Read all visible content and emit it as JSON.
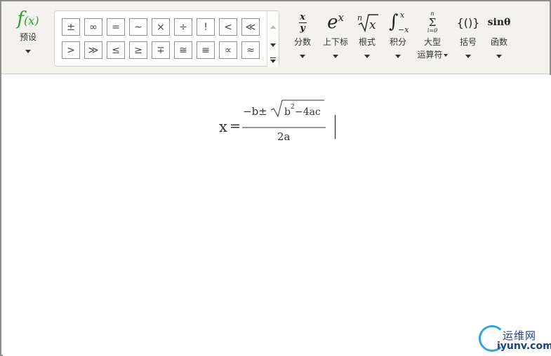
{
  "toolbar": {
    "preset": {
      "glyph": "f",
      "glyph_sub": "(x)",
      "label": "预设"
    },
    "symbols": {
      "row1": [
        "±",
        "∞",
        "=",
        "~",
        "×",
        "÷",
        "!",
        "<",
        "≪"
      ],
      "row2": [
        ">",
        "≫",
        "≤",
        "≥",
        "∓",
        "≅",
        "≡",
        "∝",
        "≈"
      ]
    },
    "tools": [
      {
        "id": "fraction",
        "label": "分数",
        "label2": ""
      },
      {
        "id": "script",
        "label": "上下标",
        "label2": ""
      },
      {
        "id": "radical",
        "label": "根式",
        "label2": ""
      },
      {
        "id": "integral",
        "label": "积分",
        "label2": ""
      },
      {
        "id": "large-operator",
        "label": "大型",
        "label2": "运算符"
      },
      {
        "id": "bracket",
        "label": "括号",
        "label2": ""
      },
      {
        "id": "function",
        "label": "函数",
        "label2": ""
      }
    ],
    "tool_glyphs": {
      "fraction_num": "x",
      "fraction_den": "y",
      "script_base": "e",
      "script_sup": "x",
      "radical_index": "n",
      "radical_body": "x",
      "integral_sign": "∫",
      "integral_upper": "x",
      "integral_lower": "−x",
      "sum_upper": "n",
      "sum_sign": "Σ",
      "sum_lower": "i=0",
      "bracket": "{()}",
      "function": "sinθ"
    }
  },
  "formula": {
    "lhs": "x",
    "equals": "=",
    "numerator_prefix": "−b±",
    "radicand_base": "b",
    "radicand_exp": "2",
    "radicand_rest": "−4ac",
    "denominator": "2a"
  },
  "watermark": {
    "name_cn": "运维网",
    "domain": "iyunv.com"
  },
  "colors": {
    "toolbar_bg": "#f3f2ec",
    "preset_green": "#2f9a3a",
    "logo_blue": "#1e3f82",
    "logo_ring": "#34a3dc"
  }
}
